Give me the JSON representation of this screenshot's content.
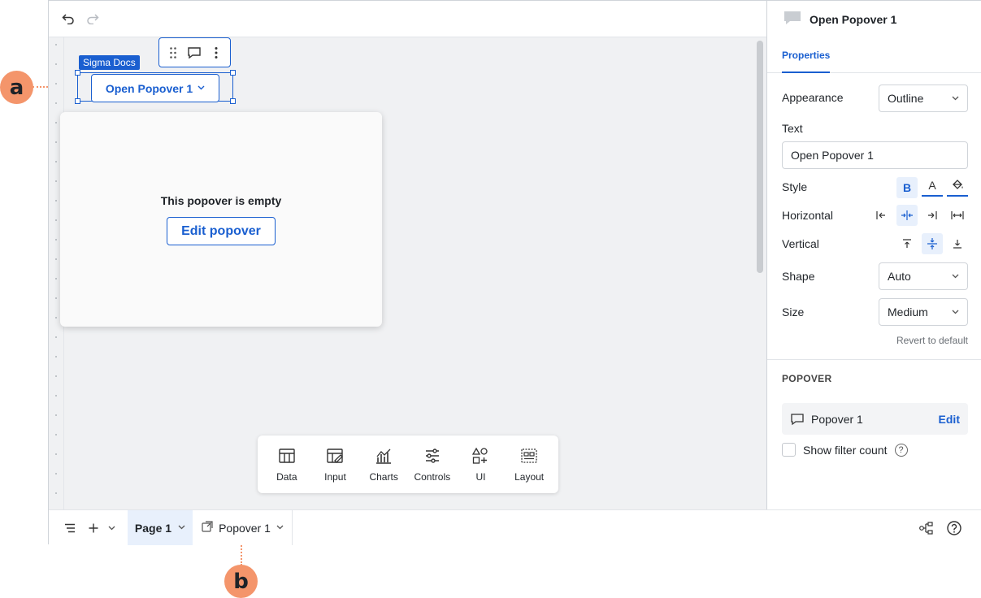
{
  "topbar": {
    "undo_icon": "undo-icon",
    "redo_icon": "redo-icon"
  },
  "canvas": {
    "element_tag": "Sigma Docs",
    "button_label": "Open Popover 1",
    "popover_empty_text": "This popover is empty",
    "edit_popover_label": "Edit popover",
    "add_bar": [
      {
        "label": "Data",
        "icon": "table-icon"
      },
      {
        "label": "Input",
        "icon": "input-icon"
      },
      {
        "label": "Charts",
        "icon": "charts-icon"
      },
      {
        "label": "Controls",
        "icon": "controls-icon"
      },
      {
        "label": "UI",
        "icon": "ui-icon"
      },
      {
        "label": "Layout",
        "icon": "layout-icon"
      }
    ]
  },
  "bottombar": {
    "page_tab": "Page 1",
    "popover_tab": "Popover 1"
  },
  "panel": {
    "title": "Open Popover 1",
    "tab": "Properties",
    "appearance_label": "Appearance",
    "appearance_value": "Outline",
    "text_label": "Text",
    "text_value": "Open Popover 1",
    "style_label": "Style",
    "style_bold": "B",
    "style_font_color": "A",
    "horizontal_label": "Horizontal",
    "vertical_label": "Vertical",
    "shape_label": "Shape",
    "shape_value": "Auto",
    "size_label": "Size",
    "size_value": "Medium",
    "revert_label": "Revert to default",
    "popover_section": "POPOVER",
    "popover_name": "Popover 1",
    "popover_edit": "Edit",
    "show_filter_count": "Show filter count",
    "help": "?"
  },
  "callouts": {
    "a": "a",
    "b": "b"
  },
  "colors": {
    "accent": "#1a5fd0",
    "callout": "#f4956b"
  }
}
